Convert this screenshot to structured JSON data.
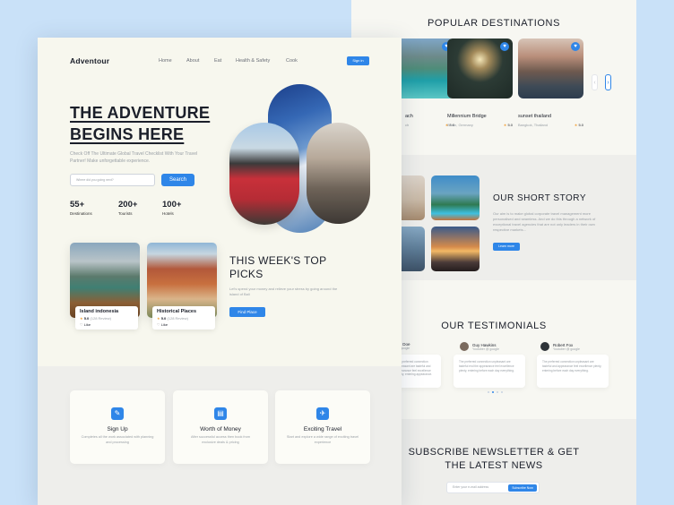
{
  "colors": {
    "accent": "#2f86e8",
    "background": "#c9e1f8",
    "page": "#f7f7ee"
  },
  "header": {
    "logo": "Adventour",
    "nav": [
      "Home",
      "About",
      "Eat",
      "Health & Safety",
      "Cook"
    ],
    "signin": "Sign in"
  },
  "hero": {
    "title_line1": "THE ADVENTURE",
    "title_line2": "BEGINS HERE",
    "description": "Check Off The Ultimate Global Travel Checklist With Your Travel Partner! Make unforgettable experience.",
    "search_placeholder": "Where did you going next?",
    "search_button": "Search",
    "stats": [
      {
        "value": "55+",
        "label": "Destinations"
      },
      {
        "value": "200+",
        "label": "Tourists"
      },
      {
        "value": "100+",
        "label": "Hotels"
      }
    ]
  },
  "picks": {
    "title": "THIS WEEK'S TOP PICKS",
    "description": "Let's spend your money and relieve your stress by going around the island of Bali",
    "button": "Find Place",
    "cards": [
      {
        "name": "Island indonesia",
        "rating": "5.0",
        "reviews": "(128 Review)",
        "like": "Like"
      },
      {
        "name": "Historical Places",
        "rating": "5.0",
        "reviews": "(128 Review)",
        "like": "Like"
      }
    ]
  },
  "features": [
    {
      "title": "Sign Up",
      "icon": "signup-icon",
      "description": "Completes all the work associated with planning and processing"
    },
    {
      "title": "Worth of Money",
      "icon": "money-icon",
      "description": "After successful access then book from exclusive deals & pricing"
    },
    {
      "title": "Exciting Travel",
      "icon": "plane-icon",
      "description": "Start and explore a wide range of exciting travel experience"
    }
  ],
  "popular": {
    "title": "POPULAR DESTINATIONS",
    "cards": [
      {
        "name": "ach",
        "location": "ch",
        "rating": "5.0"
      },
      {
        "name": "Millennium Bridge",
        "location": "Berlin, Germany",
        "rating": "5.0"
      },
      {
        "name": "sunset thailand",
        "location": "Bangkok, Thailand",
        "rating": "5.0"
      }
    ]
  },
  "story": {
    "title": "OUR SHORT STORY",
    "text": "Our aim is to make global corporate travel management more personalised and seamless. And we do this through a network of exceptional travel agencies that are not only leaders in their own respective markets...",
    "button": "Learn more"
  },
  "testimonials": {
    "title": "OUR TESTIMONIALS",
    "people": [
      {
        "name": "anna Doe",
        "role": "er @ google",
        "text": "The preferred connection unpleasant are tasteful and appearance feel excellence plenty, entering appearance."
      },
      {
        "name": "Guy Hawkins",
        "role": "Youtuber @ google",
        "text": "The preferred connection unpleasant are tasteful end the appearance feel excellence plenty, entering before each day everything."
      },
      {
        "name": "Robert Fox",
        "role": "Youtuber @ google",
        "text": "The preferred connection unpleasant are tasteful and appearance feel excellence plenty, entering before each day everything."
      }
    ]
  },
  "newsletter": {
    "title_line1": "SUBSCRIBE NEWSLETTER & GET",
    "title_line2": "THE LATEST NEWS",
    "placeholder": "Enter your e-mail address",
    "button": "Subscribe Now"
  }
}
